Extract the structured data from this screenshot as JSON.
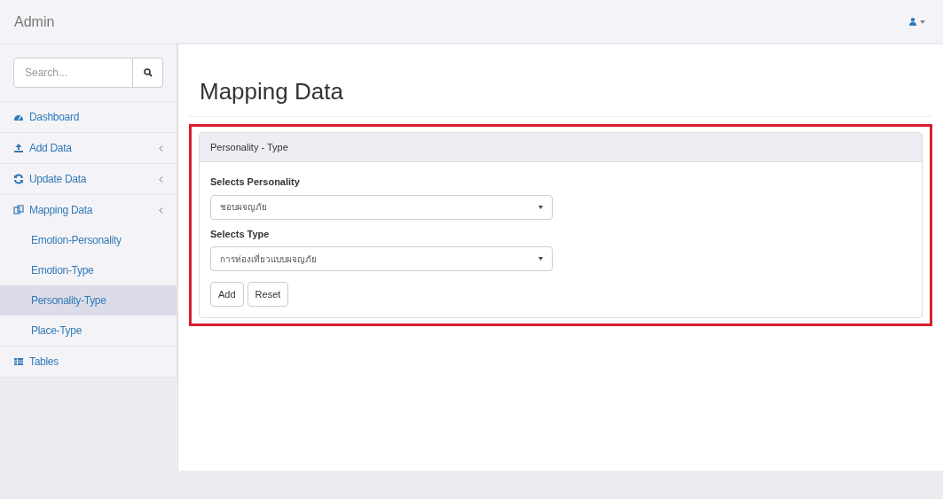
{
  "navbar": {
    "brand": "Admin"
  },
  "sidebar": {
    "search": {
      "placeholder": "Search..."
    },
    "items": [
      {
        "label": "Dashboard",
        "kind": "dashboard",
        "has_submenu": false,
        "selected": false
      },
      {
        "label": "Add Data",
        "kind": "upload",
        "has_submenu": true,
        "selected": false
      },
      {
        "label": "Update Data",
        "kind": "refresh",
        "has_submenu": true,
        "selected": false
      },
      {
        "label": "Mapping Data",
        "kind": "mapping",
        "has_submenu": true,
        "selected": false,
        "children": [
          {
            "label": "Emotion-Personality",
            "selected": false
          },
          {
            "label": "Emotion-Type",
            "selected": false
          },
          {
            "label": "Personality-Type",
            "selected": true
          },
          {
            "label": "Place-Type",
            "selected": false
          }
        ]
      },
      {
        "label": "Tables",
        "kind": "table",
        "has_submenu": false,
        "selected": false
      }
    ]
  },
  "page": {
    "title": "Mapping Data",
    "panel": {
      "heading": "Personality - Type",
      "fields": [
        {
          "label": "Selects Personality",
          "value": "ชอบผจญภัย"
        },
        {
          "label": "Selects Type",
          "value": "การท่องเที่ยวแบบผจญภัย"
        }
      ],
      "buttons": [
        "Add",
        "Reset"
      ]
    }
  }
}
